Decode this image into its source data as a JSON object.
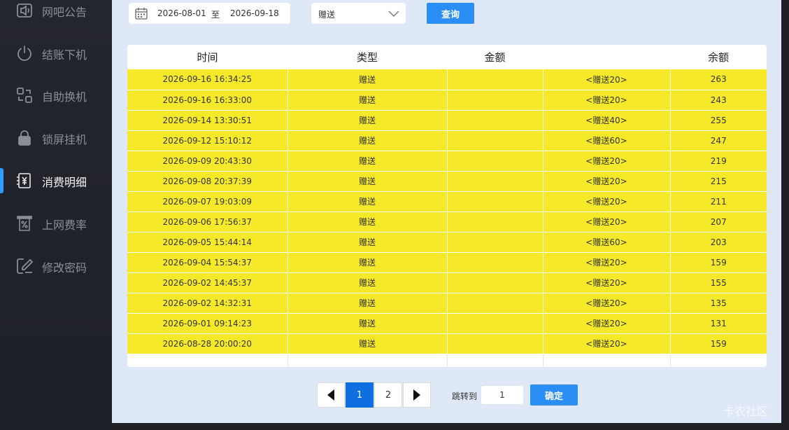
{
  "sidebar": {
    "items": [
      {
        "label": "网吧公告",
        "icon": "speaker-icon"
      },
      {
        "label": "结账下机",
        "icon": "power-icon"
      },
      {
        "label": "自助换机",
        "icon": "switch-machine-icon"
      },
      {
        "label": "锁屏挂机",
        "icon": "lock-icon"
      },
      {
        "label": "消费明细",
        "icon": "yuan-receipt-icon",
        "active": true
      },
      {
        "label": "上网费率",
        "icon": "percent-receipt-icon"
      },
      {
        "label": "修改密码",
        "icon": "edit-icon"
      }
    ],
    "accent": "#2f9bff"
  },
  "filters": {
    "start_date": "2026-08-01",
    "separator": "至",
    "end_date": "2026-09-18",
    "type_selected": "赠送",
    "query_label": "查询"
  },
  "table": {
    "headers": [
      "时间",
      "类型",
      "金额",
      "",
      "余额"
    ],
    "rows": [
      [
        "2026-09-16 16:34:25",
        "赠送",
        "",
        "<赠送20>",
        "263"
      ],
      [
        "2026-09-16 16:33:00",
        "赠送",
        "",
        "<赠送20>",
        "243"
      ],
      [
        "2026-09-14 13:30:51",
        "赠送",
        "",
        "<赠送40>",
        "255"
      ],
      [
        "2026-09-12 15:10:12",
        "赠送",
        "",
        "<赠送60>",
        "247"
      ],
      [
        "2026-09-09 20:43:30",
        "赠送",
        "",
        "<赠送20>",
        "219"
      ],
      [
        "2026-09-08 20:37:39",
        "赠送",
        "",
        "<赠送20>",
        "215"
      ],
      [
        "2026-09-07 19:03:09",
        "赠送",
        "",
        "<赠送20>",
        "211"
      ],
      [
        "2026-09-06 17:56:37",
        "赠送",
        "",
        "<赠送20>",
        "207"
      ],
      [
        "2026-09-05 15:44:14",
        "赠送",
        "",
        "<赠送60>",
        "203"
      ],
      [
        "2026-09-04 15:54:37",
        "赠送",
        "",
        "<赠送20>",
        "159"
      ],
      [
        "2026-09-02 14:45:37",
        "赠送",
        "",
        "<赠送20>",
        "155"
      ],
      [
        "2026-09-02 14:32:31",
        "赠送",
        "",
        "<赠送20>",
        "135"
      ],
      [
        "2026-09-01 09:14:23",
        "赠送",
        "",
        "<赠送20>",
        "131"
      ],
      [
        "2026-08-28 20:00:20",
        "赠送",
        "",
        "<赠送20>",
        "159"
      ]
    ],
    "row_color": "#f5e92a"
  },
  "pagination": {
    "pages": [
      "1",
      "2"
    ],
    "current": "1",
    "jump_label": "跳转到",
    "jump_value": "1",
    "confirm_label": "确定"
  },
  "watermark": "卡农社区"
}
